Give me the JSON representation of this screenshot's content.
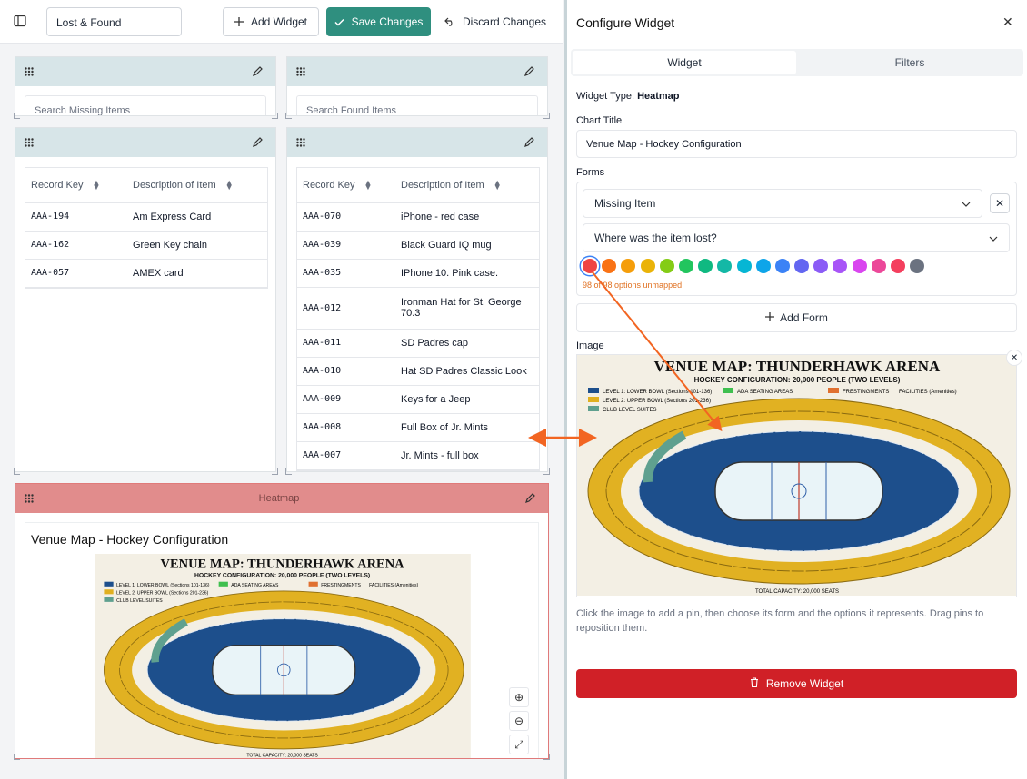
{
  "toolbar": {
    "dashboard_name": "Lost & Found",
    "add_widget_label": "Add Widget",
    "save_label": "Save Changes",
    "discard_label": "Discard Changes"
  },
  "widgets": {
    "missing_search": {
      "placeholder": "Search Missing Items"
    },
    "found_search": {
      "placeholder": "Search Found Items"
    },
    "missing_table": {
      "columns": [
        "Record Key",
        "Description of Item"
      ],
      "rows": [
        [
          "AAA-194",
          "Am Express Card"
        ],
        [
          "AAA-162",
          "Green Key chain"
        ],
        [
          "AAA-057",
          "AMEX card"
        ]
      ]
    },
    "found_table": {
      "columns": [
        "Record Key",
        "Description of Item"
      ],
      "rows": [
        [
          "AAA-070",
          "iPhone - red case"
        ],
        [
          "AAA-039",
          "Black Guard IQ mug"
        ],
        [
          "AAA-035",
          "IPhone 10. Pink case."
        ],
        [
          "AAA-012",
          "Ironman Hat for St. George 70.3"
        ],
        [
          "AAA-011",
          "SD Padres cap"
        ],
        [
          "AAA-010",
          "Hat SD Padres Classic Look"
        ],
        [
          "AAA-009",
          "Keys for a Jeep"
        ],
        [
          "AAA-008",
          "Full Box of Jr. Mints"
        ],
        [
          "AAA-007",
          "Jr. Mints - full box"
        ]
      ]
    },
    "heatmap": {
      "header_label": "Heatmap",
      "title": "Venue Map - Hockey Configuration"
    }
  },
  "venue_map": {
    "title": "VENUE MAP: THUNDERHAWK ARENA",
    "subtitle": "HOCKEY CONFIGURATION: 20,000 PEOPLE (TWO LEVELS)",
    "legend": [
      {
        "label": "LEVEL 1: LOWER BOWL (Sections 101-136)",
        "color": "#1d4f8c"
      },
      {
        "label": "LEVEL 2: UPPER BOWL (Sections 201-236)",
        "color": "#e0b020"
      },
      {
        "label": "CLUB LEVEL SUITES",
        "color": "#5fa08f"
      },
      {
        "label": "ADA SEATING AREAS",
        "color": "#3fbf4f"
      },
      {
        "label": "FRESTINGMENTS",
        "color": "#e07030"
      },
      {
        "label": "FACILITIES (Amenities)",
        "color": "#333333"
      }
    ],
    "footer": "TOTAL CAPACITY: 20,000 SEATS"
  },
  "panel": {
    "title": "Configure Widget",
    "tabs": [
      "Widget",
      "Filters"
    ],
    "widget_type_label": "Widget Type:",
    "widget_type_value": "Heatmap",
    "chart_title_label": "Chart Title",
    "chart_title_value": "Venue Map - Hockey Configuration",
    "forms_label": "Forms",
    "form_select": "Missing Item",
    "question_select": "Where was the item lost?",
    "unmapped_note": "98 of 98 options unmapped",
    "add_form_label": "Add Form",
    "image_label": "Image",
    "help_text": "Click the image to add a pin, then choose its form and the options it represents. Drag pins to reposition them.",
    "remove_label": "Remove Widget",
    "swatches": [
      "#ef4444",
      "#f97316",
      "#f59e0b",
      "#eab308",
      "#84cc16",
      "#22c55e",
      "#10b981",
      "#14b8a6",
      "#06b6d4",
      "#0ea5e9",
      "#3b82f6",
      "#6366f1",
      "#8b5cf6",
      "#a855f7",
      "#d946ef",
      "#ec4899",
      "#f43f5e",
      "#6b7280"
    ]
  },
  "colors": {
    "accent": "#2f8f7f",
    "danger": "#d02027",
    "arrow": "#f26522"
  }
}
